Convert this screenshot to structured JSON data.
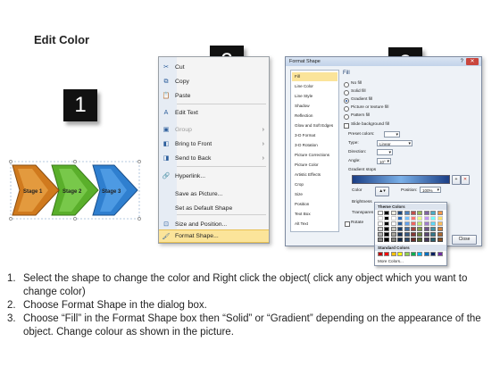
{
  "title": "Edit Color",
  "steps": [
    "1",
    "2",
    "3"
  ],
  "shapes": {
    "labels": [
      "Stage 1",
      "Stage 2",
      "Stage 3"
    ],
    "colors": [
      "#d07a1e",
      "#5aaf2b",
      "#2f7fcf"
    ]
  },
  "context_menu": {
    "items": [
      {
        "icon": "✂",
        "icon_name": "cut-icon",
        "label": "Cut",
        "disabled": false,
        "submenu": false
      },
      {
        "icon": "⧉",
        "icon_name": "copy-icon",
        "label": "Copy",
        "disabled": false,
        "submenu": false
      },
      {
        "icon": "📋",
        "icon_name": "paste-icon",
        "label": "Paste",
        "disabled": false,
        "submenu": false
      },
      {
        "icon": "A",
        "icon_name": "edit-text-icon",
        "label": "Edit Text",
        "disabled": false,
        "submenu": false
      },
      {
        "icon": "▣",
        "icon_name": "group-icon",
        "label": "Group",
        "disabled": true,
        "submenu": true
      },
      {
        "icon": "◧",
        "icon_name": "bring-to-front-icon",
        "label": "Bring to Front",
        "disabled": false,
        "submenu": true
      },
      {
        "icon": "◨",
        "icon_name": "send-to-back-icon",
        "label": "Send to Back",
        "disabled": false,
        "submenu": true
      },
      {
        "icon": "🔗",
        "icon_name": "hyperlink-icon",
        "label": "Hyperlink...",
        "disabled": false,
        "submenu": false
      },
      {
        "icon": "",
        "icon_name": "save-as-picture-icon",
        "label": "Save as Picture...",
        "disabled": false,
        "submenu": false
      },
      {
        "icon": "",
        "icon_name": "set-default-shape-icon",
        "label": "Set as Default Shape",
        "disabled": false,
        "submenu": false
      },
      {
        "icon": "⊡",
        "icon_name": "size-position-icon",
        "label": "Size and Position...",
        "disabled": false,
        "submenu": false
      },
      {
        "icon": "🖌",
        "icon_name": "format-shape-icon",
        "label": "Format Shape...",
        "disabled": false,
        "submenu": false
      }
    ]
  },
  "dialog": {
    "title": "Format Shape",
    "categories": [
      "Fill",
      "Line Color",
      "Line Style",
      "Shadow",
      "Reflection",
      "Glow and Soft Edges",
      "3-D Format",
      "3-D Rotation",
      "Picture Corrections",
      "Picture Color",
      "Artistic Effects",
      "Crop",
      "Size",
      "Position",
      "Text Box",
      "Alt Text"
    ],
    "selected_category": "Fill",
    "section": "Fill",
    "fill_options": [
      "No fill",
      "Solid fill",
      "Gradient fill",
      "Picture or texture fill",
      "Pattern fill"
    ],
    "selected_fill": "Gradient fill",
    "slide_bg": "Slide background fill",
    "preset_label": "Preset colors:",
    "type_label": "Type:",
    "type_value": "Linear",
    "direction_label": "Direction:",
    "angle_label": "Angle:",
    "angle_value": "10°",
    "stops_label": "Gradient stops",
    "color_label": "Color",
    "position_label": "Position:",
    "position_value": "100%",
    "brightness_label": "Brightness",
    "transparency_label": "Transparen",
    "rotate_label": "Rotate",
    "close_label": "Close"
  },
  "color_popup": {
    "theme_label": "Theme Colors",
    "standard_label": "Standard Colors",
    "more_label": "More Colors...",
    "theme_top": [
      "#ffffff",
      "#000000",
      "#eeece1",
      "#1f497d",
      "#4f81bd",
      "#c0504d",
      "#9bbb59",
      "#8064a2",
      "#4bacc6",
      "#f79646"
    ],
    "standard": [
      "#c00000",
      "#ff0000",
      "#ffc000",
      "#ffff00",
      "#92d050",
      "#00b050",
      "#00b0f0",
      "#0070c0",
      "#002060",
      "#7030a0"
    ]
  },
  "instructions": [
    {
      "num": "1.",
      "text": "Select the shape to change the color and Right click the object( click any object which you want to change color)"
    },
    {
      "num": "2.",
      "text": "Choose Format Shape in the dialog box."
    },
    {
      "num": "3.",
      "text": "Choose “Fill” in the Format Shape box then “Solid” or “Gradient” depending on the appearance of the object. Change colour as shown in the picture."
    }
  ]
}
